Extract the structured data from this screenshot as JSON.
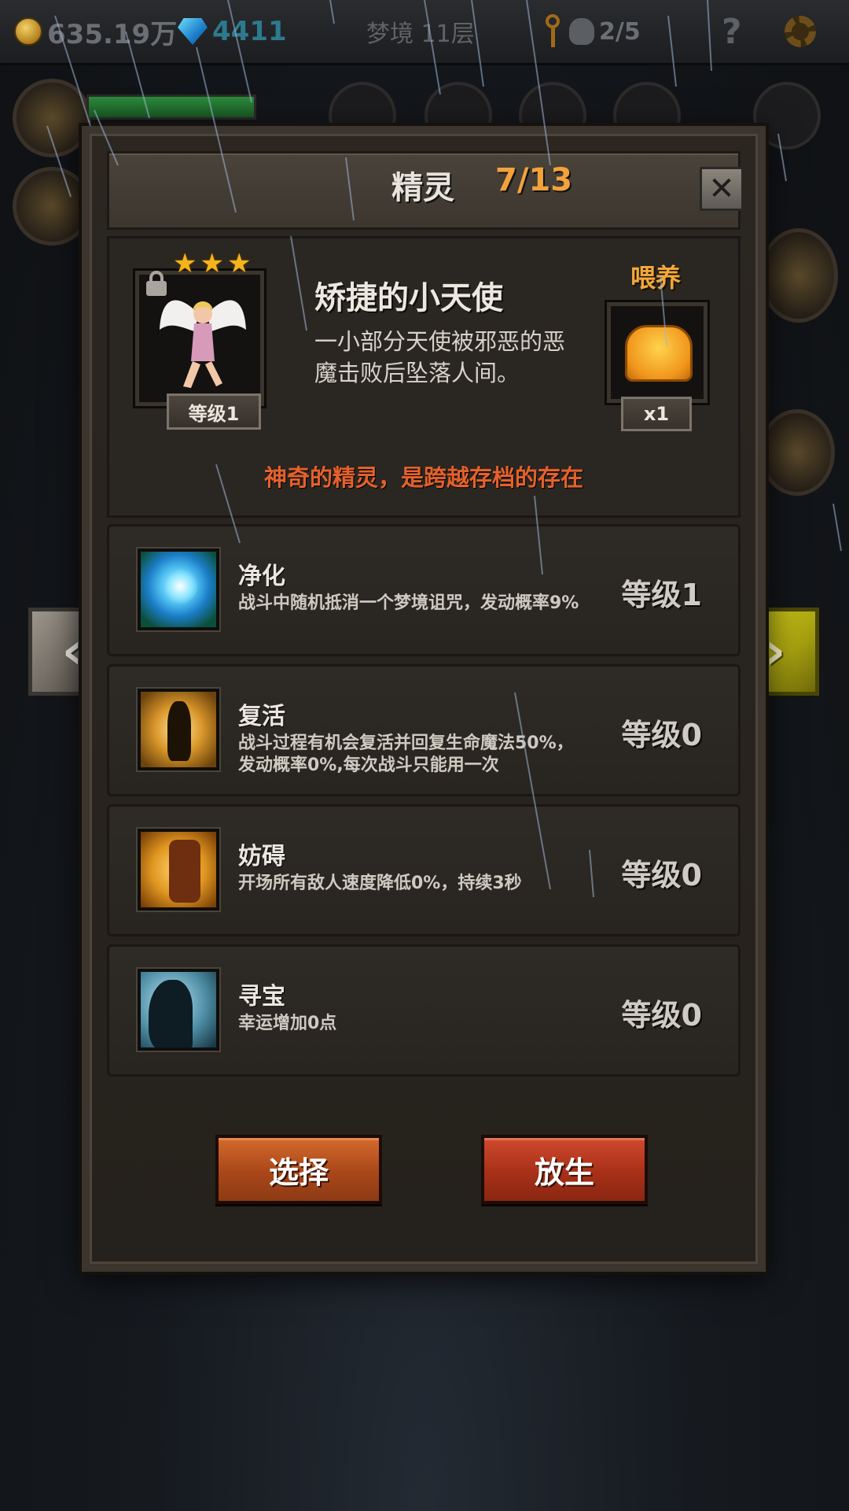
{
  "topbar": {
    "gold": "635.19万",
    "gems": "4411",
    "floor": "梦境 11层",
    "skulls": "2/5",
    "help": "?"
  },
  "panel": {
    "title": "精灵",
    "count": "7/13",
    "close": "✕"
  },
  "spirit": {
    "name": "矫捷的小天使",
    "description": "一小部分天使被邪恶的恶魔击败后坠落人间。",
    "level": "等级1",
    "stars": [
      "★",
      "★",
      "★"
    ],
    "feed_label": "喂养",
    "feed_qty": "x1",
    "notice": "神奇的精灵，是跨越存档的存在"
  },
  "skills": [
    {
      "name": "净化",
      "desc": "战斗中随机抵消一个梦境诅咒，发动概率9%",
      "level": "等级1"
    },
    {
      "name": "复活",
      "desc": "战斗过程有机会复活并回复生命魔法50%，发动概率0%,每次战斗只能用一次",
      "level": "等级0"
    },
    {
      "name": "妨碍",
      "desc": "开场所有敌人速度降低0%，持续3秒",
      "level": "等级0"
    },
    {
      "name": "寻宝",
      "desc": "幸运增加0点",
      "level": "等级0"
    }
  ],
  "buttons": {
    "select": "选择",
    "release": "放生",
    "prev": "‹",
    "next": "›"
  },
  "colors": {
    "accent_orange": "#f3a23a",
    "notice_red": "#e4612c",
    "next_arrow_yellow": "#c9c219"
  }
}
